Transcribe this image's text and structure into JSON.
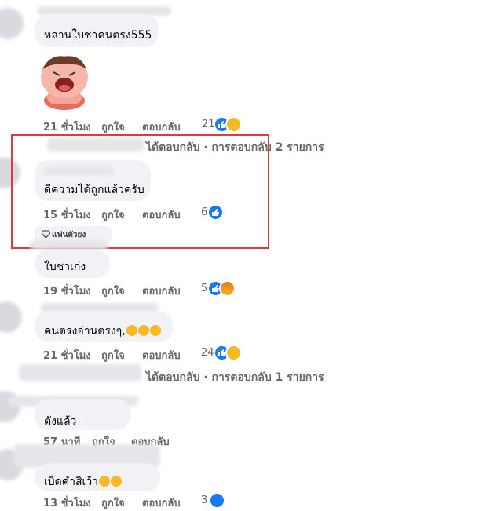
{
  "comments": [
    {
      "text": "หลานใบชาคนตรง555",
      "time": "21 ชั่วโมง",
      "like": "ถูกใจ",
      "reply": "ตอบกลับ",
      "count": "21"
    },
    {
      "text": "ดีความได้ถูกแล้วครับ",
      "time": "15 ชั่วโมง",
      "like": "ถูกใจ",
      "reply": "ตอบกลับ",
      "count": "6",
      "badge": "แฟนตัวยง"
    },
    {
      "text": "ใบชาเก่ง",
      "time": "19 ชั่วโมง",
      "like": "ถูกใจ",
      "reply": "ตอบกลับ",
      "count": "5"
    },
    {
      "text": "คนตรงอ่านตรงๆ,",
      "time": "21 ชั่วโมง",
      "like": "ถูกใจ",
      "reply": "ตอบกลับ",
      "count": "24"
    },
    {
      "text": "ตังแล้ว",
      "time": "57 นาที",
      "like": "ถูกใจ",
      "reply": "ตอบกลับ"
    },
    {
      "text": "เบิดคำสิเว้า",
      "time": "13 ชั่วโมง",
      "like": "ถูกใจ",
      "reply": "ตอบกลับ",
      "count": "3"
    }
  ],
  "reply_summaries": [
    "ได้ตอบกลับ · การตอบกลับ 2 รายการ",
    "ได้ตอบกลับ · การตอบกลับ 1 รายการ"
  ],
  "colors": {
    "highlight_box": "#e0393e",
    "like_blue": "#1877f2",
    "bubble": "#f0f2f5"
  }
}
